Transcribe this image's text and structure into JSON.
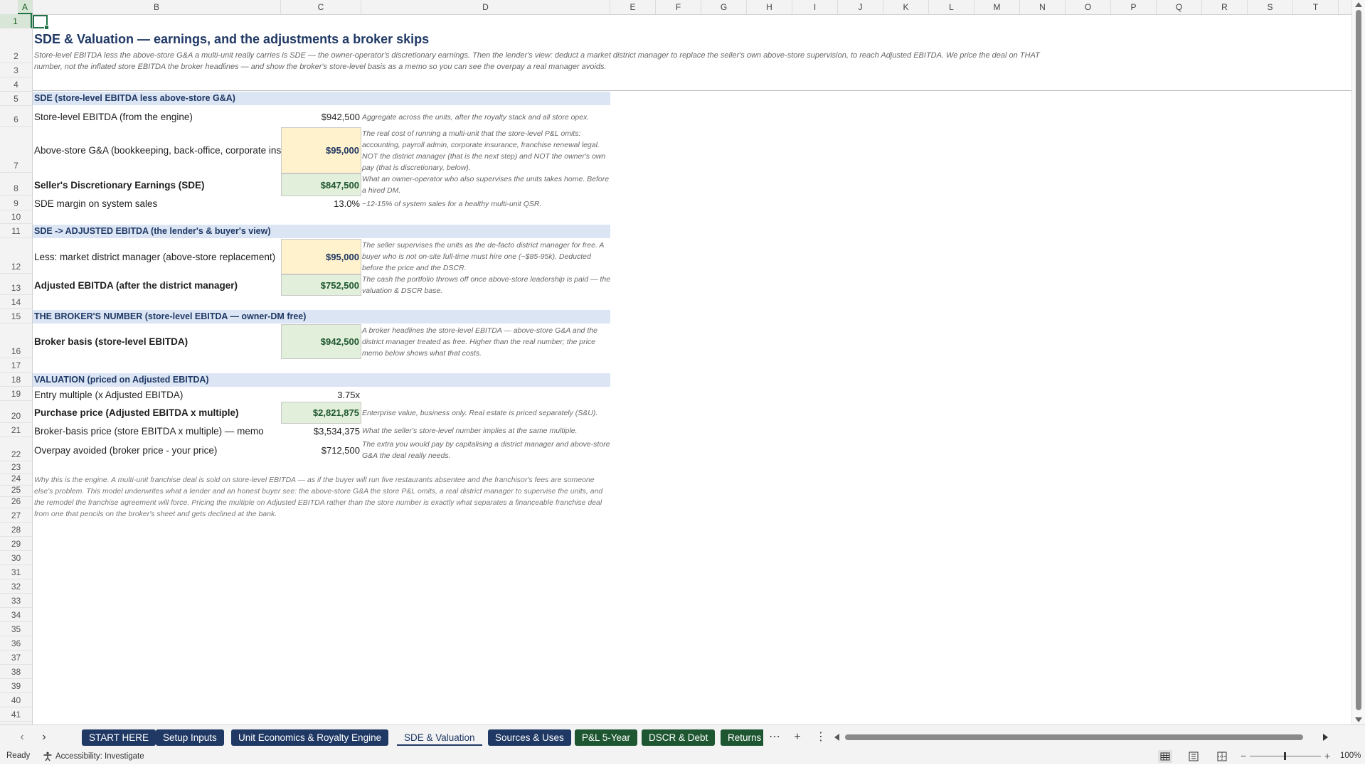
{
  "columns": [
    "A",
    "B",
    "C",
    "D",
    "E",
    "F",
    "G",
    "H",
    "I",
    "J",
    "K",
    "L",
    "M",
    "N",
    "O",
    "P",
    "Q",
    "R",
    "S",
    "T"
  ],
  "rows": [
    "1",
    "2",
    "3",
    "4",
    "5",
    "6",
    "7",
    "8",
    "9",
    "10",
    "11",
    "12",
    "13",
    "14",
    "15",
    "16",
    "17",
    "18",
    "19",
    "20",
    "21",
    "22",
    "23",
    "24",
    "25",
    "26",
    "27",
    "28",
    "29",
    "30",
    "31",
    "32",
    "33",
    "34",
    "35",
    "36",
    "37",
    "38",
    "39",
    "40",
    "41"
  ],
  "sheet": {
    "title": "SDE & Valuation — earnings, and the adjustments a broker skips",
    "subtitle": "Store-level EBITDA less the above-store G&A a multi-unit really carries is SDE — the owner-operator's discretionary earnings. Then the lender's view: deduct a market district manager to replace the seller's own above-store supervision, to reach Adjusted EBITDA. We price the deal on THAT number, not the inflated store EBITDA the broker headlines — and show the broker's store-level basis as a memo so you can see the overpay a real manager avoids.",
    "sections": {
      "sde": "SDE  (store-level EBITDA less above-store G&A)",
      "adjusted": "SDE -> ADJUSTED EBITDA  (the lender's & buyer's view)",
      "broker": "THE BROKER'S NUMBER  (store-level EBITDA — owner-DM free)",
      "valuation": "VALUATION  (priced on Adjusted EBITDA)"
    },
    "lines": {
      "store_ebitda": {
        "label": "Store-level EBITDA (from the engine)",
        "value": "$942,500",
        "note": "Aggregate across the units, after the royalty stack and all store opex."
      },
      "above_store_ga": {
        "label": "Above-store G&A (bookkeeping, back-office, corporate insurance, legal)",
        "value": "$95,000",
        "note": "The real cost of running a multi-unit that the store-level P&L omits: accounting, payroll admin, corporate insurance, franchise renewal legal. NOT the district manager (that is the next step) and NOT the owner's own pay (that is discretionary, below)."
      },
      "sde": {
        "label": "Seller's Discretionary Earnings (SDE)",
        "value": "$847,500",
        "note": "What an owner-operator who also supervises the units takes home. Before a hired DM."
      },
      "sde_margin": {
        "label": "SDE margin on system sales",
        "value": "13.0%",
        "note": "~12-15% of system sales for a healthy multi-unit QSR."
      },
      "district_manager": {
        "label": "Less: market district manager (above-store replacement)",
        "value": "$95,000",
        "note": "The seller supervises the units as the de-facto district manager for free. A buyer who is not on-site full-time must hire one (~$85-95k). Deducted before the price and the DSCR."
      },
      "adjusted_ebitda": {
        "label": "Adjusted EBITDA (after the district manager)",
        "value": "$752,500",
        "note": "The cash the portfolio throws off once above-store leadership is paid — the valuation & DSCR base."
      },
      "broker_basis": {
        "label": "Broker basis (store-level EBITDA)",
        "value": "$942,500",
        "note": "A broker headlines the store-level EBITDA — above-store G&A and the district manager treated as free. Higher than the real number; the price memo below shows what that costs."
      },
      "entry_multiple": {
        "label": "Entry multiple (x Adjusted EBITDA)",
        "value": "3.75x",
        "note": ""
      },
      "purchase_price": {
        "label": "Purchase price (Adjusted EBITDA x multiple)",
        "value": "$2,821,875",
        "note": "Enterprise value, business only. Real estate is priced separately (S&U)."
      },
      "broker_price": {
        "label": "Broker-basis price (store EBITDA x multiple) — memo",
        "value": "$3,534,375",
        "note": "What the seller's store-level number implies at the same multiple."
      },
      "overpay": {
        "label": "Overpay avoided (broker price - your price)",
        "value": "$712,500",
        "note": "The extra you would pay by capitalising a district manager and above-store G&A the deal really needs."
      }
    },
    "footnote": "Why this is the engine. A multi-unit franchise deal is sold on store-level EBITDA — as if the buyer will run five restaurants absentee and the franchisor's fees are someone else's problem. This model underwrites what a lender and an honest buyer see: the above-store G&A the store P&L omits, a real district manager to supervise the units, and the remodel the franchise agreement will force. Pricing the multiple on Adjusted EBITDA rather than the store number is exactly what separates a financeable franchise deal from one that pencils on the broker's sheet and gets declined at the bank."
  },
  "tabs": {
    "items": [
      {
        "label": "START HERE",
        "color": "navy"
      },
      {
        "label": "Setup Inputs",
        "color": "navy"
      },
      {
        "label": "Unit Economics & Royalty Engine",
        "color": "navy"
      },
      {
        "label": "SDE & Valuation",
        "color": "active"
      },
      {
        "label": "Sources & Uses",
        "color": "navy"
      },
      {
        "label": "P&L 5-Year",
        "color": "green"
      },
      {
        "label": "DSCR & Debt",
        "color": "green"
      },
      {
        "label": "Returns",
        "color": "green"
      }
    ],
    "more_icon": "ellipsis-icon",
    "add_icon": "plus-icon",
    "options_icon": "vertical-ellipsis-icon"
  },
  "status": {
    "ready": "Ready",
    "accessibility": "Accessibility: Investigate",
    "zoom": "100%",
    "zoom_level": 100
  },
  "colors": {
    "navy": "#1f3864",
    "green": "#1e5631",
    "input_fill": "#fff2cc",
    "calc_fill": "#e2efda",
    "section_fill": "#dbe5f4",
    "selection": "#217346"
  }
}
